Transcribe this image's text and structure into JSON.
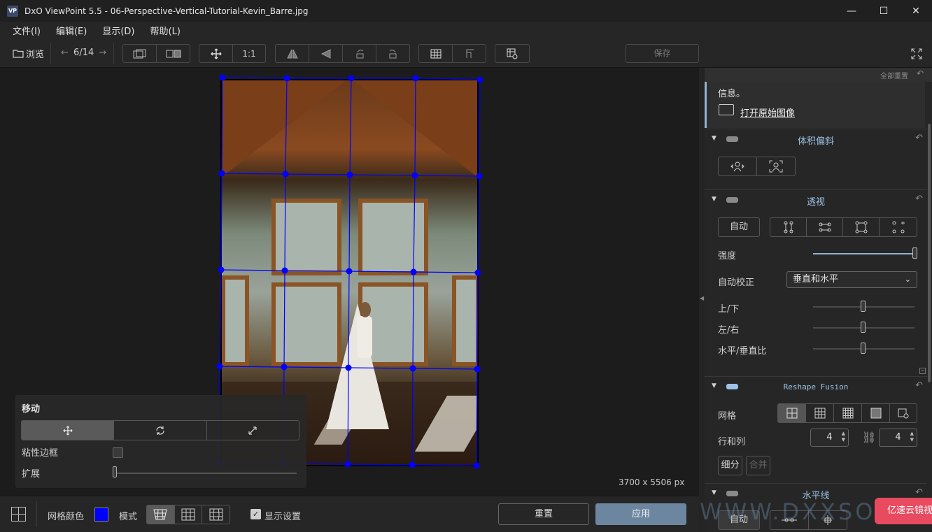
{
  "window": {
    "app_icon_text": "VP",
    "title": "DxO ViewPoint 5.5 - 06-Perspective-Vertical-Tutorial-Kevin_Barre.jpg",
    "minimize": "—",
    "maximize": "☐",
    "close": "✕"
  },
  "menu": [
    "文件(I)",
    "编辑(E)",
    "显示(D)",
    "帮助(L)"
  ],
  "toolbar": {
    "browse_label": "浏览",
    "counter": "6/14",
    "prev_arrow": "←",
    "next_arrow": "→",
    "zoom_1to1": "1:1",
    "save_label": "保存"
  },
  "canvas": {
    "image_size": "3700 x 5506 px",
    "grid_color": "#0000ff"
  },
  "move_panel": {
    "title": "移动",
    "sticky_border_label": "粘性边框",
    "sticky_border_checked": false,
    "expand_label": "扩展",
    "expand_value": 0
  },
  "bottom": {
    "grid_color_label": "网格颜色",
    "grid_color": "#0000ff",
    "mode_label": "模式",
    "show_settings_label": "显示设置",
    "show_settings_checked": true,
    "reset_label": "重置",
    "apply_label": "应用"
  },
  "right_panel": {
    "reset_all": "全部重置",
    "info_text": "信息。",
    "open_original": "打开原始图像",
    "volume_anamorphosis": {
      "title": "体积偏斜"
    },
    "perspective": {
      "title": "透视",
      "auto_label": "自动",
      "strength_label": "强度",
      "strength_value": 1.0,
      "auto_correct_label": "自动校正",
      "auto_correct_value": "垂直和水平",
      "up_down_label": "上/下",
      "up_down_value": 0.5,
      "left_right_label": "左/右",
      "left_right_value": 0.5,
      "ratio_label": "水平/垂直比",
      "ratio_value": 0.5
    },
    "reshape_fusion": {
      "title": "Reshape Fusion",
      "grid_label": "网格",
      "rows_cols_label": "行和列",
      "rows": "4",
      "cols": "4",
      "subdivide_label": "细分",
      "merge_label": "合并"
    },
    "horizon": {
      "title": "水平线",
      "auto_label": "自动"
    }
  },
  "overlay": {
    "watermark": "WWW.DXXSOFT.COM",
    "badge": "亿速云镜视"
  }
}
